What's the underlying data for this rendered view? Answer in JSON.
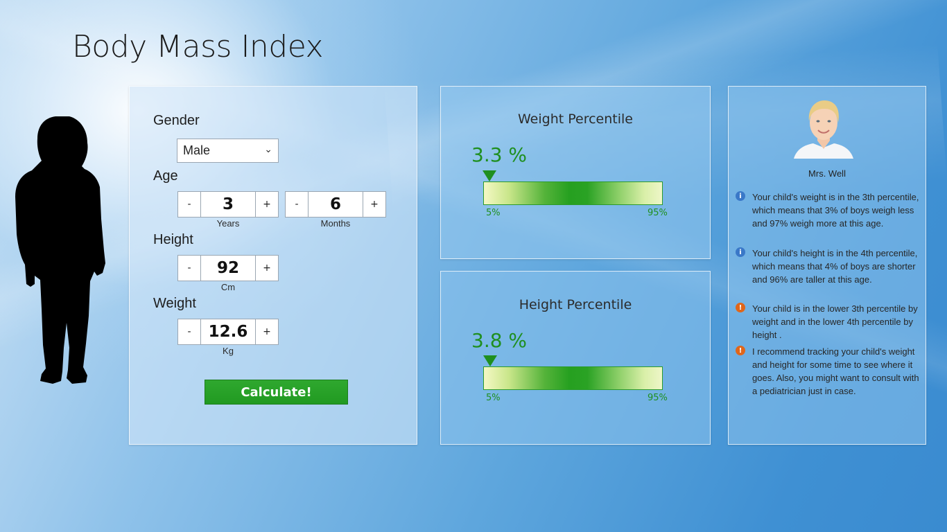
{
  "app": {
    "title": "Body Mass Index"
  },
  "form": {
    "gender": {
      "label": "Gender",
      "selected": "Male"
    },
    "age": {
      "label": "Age",
      "years": {
        "value": "3",
        "unit": "Years",
        "minus": "-",
        "plus": "+"
      },
      "months": {
        "value": "6",
        "unit": "Months",
        "minus": "-",
        "plus": "+"
      }
    },
    "height": {
      "label": "Height",
      "value": "92",
      "unit": "Cm",
      "minus": "-",
      "plus": "+"
    },
    "weight": {
      "label": "Weight",
      "value": "12.6",
      "unit": "Kg",
      "minus": "-",
      "plus": "+"
    },
    "calculate_label": "Calculate!"
  },
  "weight_percentile": {
    "title": "Weight Percentile",
    "value_text": "3.3 %",
    "value": 3.3,
    "low_label": "5%",
    "high_label": "95%"
  },
  "height_percentile": {
    "title": "Height Percentile",
    "value_text": "3.8 %",
    "value": 3.8,
    "low_label": "5%",
    "high_label": "95%"
  },
  "doctor": {
    "name": "Mrs. Well",
    "messages": [
      {
        "icon": "info-icon",
        "text": "Your child's weight is in the 3th percentile, which means that 3% of boys weigh less and 97% weigh more at this age."
      },
      {
        "icon": "info-icon",
        "text": "Your child's height is in the 4th percentile, which means that 4% of boys are shorter and 96% are taller at this age."
      },
      {
        "icon": "warning-icon",
        "text": "Your child is in the lower 3th percentile by weight and in the lower 4th percentile by height ."
      },
      {
        "icon": "warning-icon",
        "text": "I recommend tracking your child's weight and height for some time to see where it goes. Also, you might want to consult with a pediatrician just in case."
      }
    ]
  },
  "colors": {
    "accent_green": "#1f8f1f",
    "button_green": "#2fa82f",
    "info_blue": "#3a78c8",
    "warning_orange": "#e0661a"
  }
}
